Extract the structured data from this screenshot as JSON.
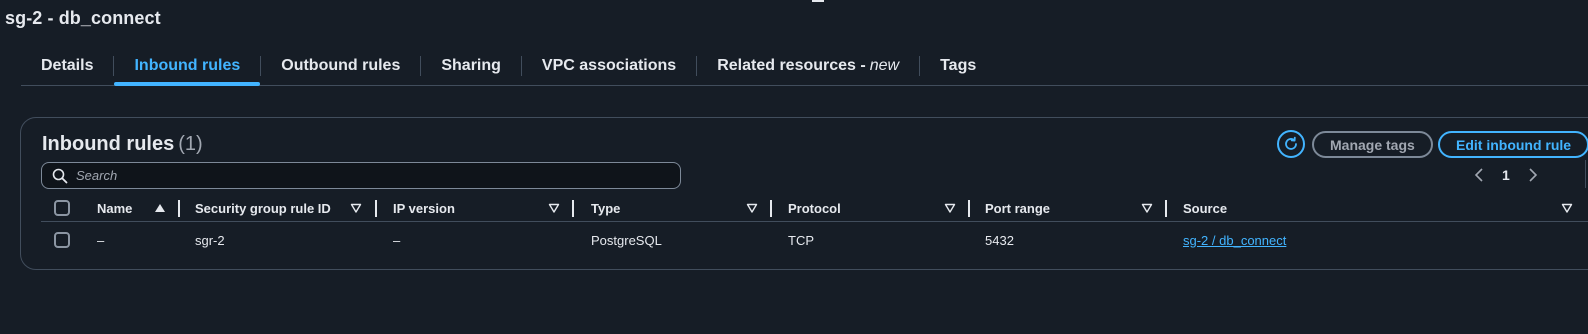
{
  "page": {
    "title": "sg-2 - db_connect"
  },
  "tabs": [
    {
      "label": "Details"
    },
    {
      "label": "Inbound rules"
    },
    {
      "label": "Outbound rules"
    },
    {
      "label": "Sharing"
    },
    {
      "label": "VPC associations"
    },
    {
      "label": "Related resources -",
      "badge": "new"
    },
    {
      "label": "Tags"
    }
  ],
  "active_tab": "Inbound rules",
  "panel": {
    "title": "Inbound rules",
    "count": "(1)",
    "manage_tags_label": "Manage tags",
    "edit_label": "Edit inbound rule"
  },
  "search": {
    "placeholder": "Search",
    "value": ""
  },
  "pagination": {
    "current_page": "1"
  },
  "table": {
    "columns": [
      "Name",
      "Security group rule ID",
      "IP version",
      "Type",
      "Protocol",
      "Port range",
      "Source"
    ],
    "rows": [
      {
        "name": "–",
        "rule_id": "sgr-2",
        "ip_version": "–",
        "type": "PostgreSQL",
        "protocol": "TCP",
        "port_range": "5432",
        "source": "sg-2 / db_connect"
      }
    ]
  },
  "colors": {
    "background": "#161d26",
    "accent": "#42b4ff",
    "border": "#414d5c",
    "text": "#e6e9ee",
    "muted": "#a1a7b1"
  }
}
